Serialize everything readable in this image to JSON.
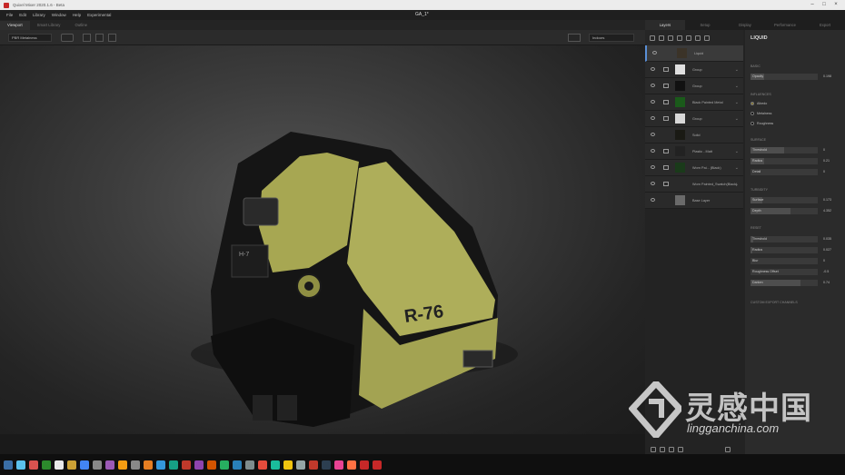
{
  "app": {
    "title": "Quixel Mixer 2020.1.6 - Beta",
    "doc_title": "GA_1*"
  },
  "menu": [
    "File",
    "Edit",
    "Library",
    "Window",
    "Help",
    "Experimental"
  ],
  "viewport_tabs": [
    "Viewport",
    "Smart Library",
    "Outline"
  ],
  "toolbar": {
    "render_mode": "PBR Metalness",
    "env": "Indoors"
  },
  "right_tabs": [
    "Layers",
    "Setup",
    "Display",
    "Performance",
    "Export"
  ],
  "layers": [
    {
      "name": "Liquid",
      "selected": true,
      "thumb": "#3b3328",
      "folder": false,
      "chevron": false
    },
    {
      "name": "Group",
      "selected": false,
      "thumb": "#e0e0e0",
      "folder": true,
      "chevron": true
    },
    {
      "name": "Group",
      "selected": false,
      "thumb": "#111111",
      "folder": true,
      "chevron": true
    },
    {
      "name": "Black Painted Metal",
      "selected": false,
      "thumb": "#1a5a1a",
      "folder": true,
      "chevron": true
    },
    {
      "name": "Group",
      "selected": false,
      "thumb": "#d8d8d8",
      "folder": true,
      "chevron": true
    },
    {
      "name": "Solid",
      "selected": false,
      "thumb": "#1a1a14",
      "folder": false,
      "chevron": false
    },
    {
      "name": "Plastic - Matt",
      "selected": false,
      "thumb": "#222222",
      "folder": true,
      "chevron": true
    },
    {
      "name": "Worn Pai... (Black)",
      "selected": false,
      "thumb": "#1a3a1a",
      "folder": true,
      "chevron": true
    },
    {
      "name": "Worn Painted_Swatch(Black)",
      "selected": false,
      "thumb": "#2a2a2a",
      "folder": true,
      "chevron": true
    },
    {
      "name": "Base Layer",
      "selected": false,
      "thumb": "#6a6a6a",
      "folder": false,
      "chevron": false
    }
  ],
  "props": {
    "title": "LIQUID",
    "basic_label": "BASIC",
    "opacity": {
      "label": "Opacity",
      "value": "0.198",
      "fraction": 0.2
    },
    "influences_label": "INFLUENCES",
    "channels": [
      {
        "label": "Albedo",
        "color": "#8a7a2a"
      },
      {
        "label": "Metalness",
        "color": "#000000"
      },
      {
        "label": "Roughness",
        "color": "#000000"
      }
    ],
    "surface_label": "SURFACE",
    "surface_rows": [
      {
        "label": "Threshold",
        "value": "0",
        "fraction": 0.5
      },
      {
        "label": "Radius",
        "value": "0.21",
        "fraction": 0.2
      },
      {
        "label": "Detail",
        "value": "0",
        "fraction": 0.0
      }
    ],
    "turbidity_label": "TURBIDITY",
    "turbidity_rows": [
      {
        "label": "Surface",
        "value": "0.173",
        "fraction": 0.17
      },
      {
        "label": "Depth",
        "value": "4.352",
        "fraction": 0.6
      }
    ],
    "reset_label": "RESET",
    "reset_rows": [
      {
        "label": "Threshold",
        "value": "0.035",
        "fraction": 0.04
      },
      {
        "label": "Radius",
        "value": "0.027",
        "fraction": 0.03
      },
      {
        "label": "Blur",
        "value": "0",
        "fraction": 0.0
      },
      {
        "label": "Roughness Offset",
        "value": "-0.5",
        "fraction": 0.0
      },
      {
        "label": "Darken",
        "value": "0.74",
        "fraction": 0.74
      }
    ],
    "custom_label": "CUSTOM EXPORT CHANNELS"
  },
  "model": {
    "label": "R-76",
    "sub_label": "H-7"
  },
  "watermark": {
    "zh": "灵感中国",
    "en": "lingganchina.com"
  },
  "taskbar_icons": [
    "#3a6ea5",
    "#5bc0eb",
    "#d9534f",
    "#2c8a2c",
    "#e8e8e8",
    "#cba135",
    "#4285f4",
    "#888",
    "#9b59b6",
    "#f39c12",
    "#888",
    "#e67e22",
    "#3498db",
    "#16a085",
    "#c0392b",
    "#8e44ad",
    "#d35400",
    "#27ae60",
    "#2980b9",
    "#7f8c8d",
    "#e74c3c",
    "#1abc9c",
    "#f1c40f",
    "#95a5a6",
    "#c0392b",
    "#2c3e50",
    "#e84393",
    "#ff7043",
    "#c62828",
    "#c62828"
  ]
}
